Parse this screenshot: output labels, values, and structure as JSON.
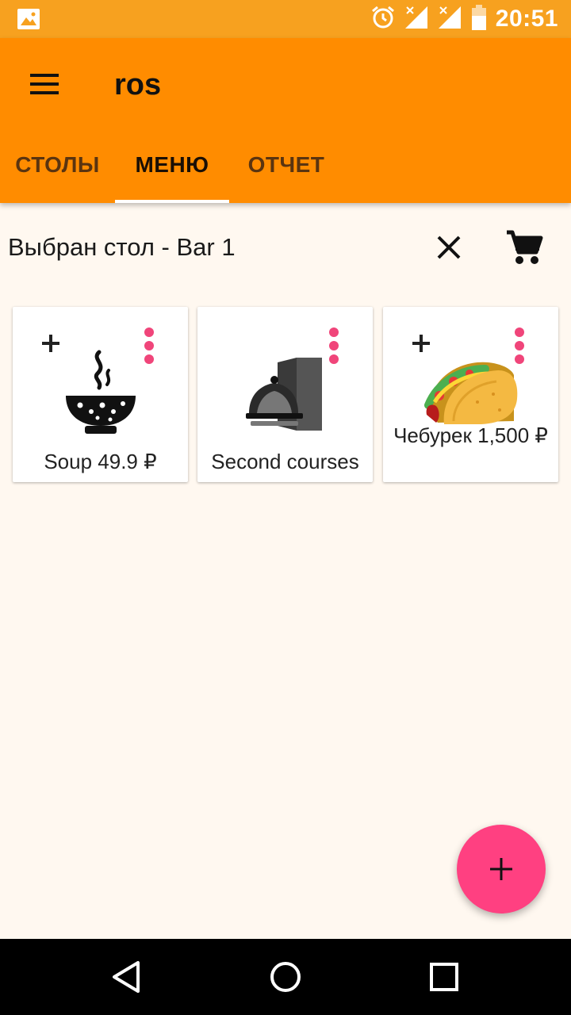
{
  "status_bar": {
    "time": "20:51",
    "icons": [
      "gallery-icon",
      "alarm-icon",
      "signal-off-icon",
      "signal-off-icon",
      "battery-icon"
    ]
  },
  "app_bar": {
    "title": "ros",
    "menu_icon": "menu-icon"
  },
  "tabs": [
    {
      "label": "СТОЛЫ",
      "active": false
    },
    {
      "label": "МЕНЮ",
      "active": true
    },
    {
      "label": "ОТЧЕТ",
      "active": false
    }
  ],
  "table_row": {
    "label": "Выбран стол - Bar 1",
    "clear_icon": "close-icon",
    "cart_icon": "cart-icon"
  },
  "menu_items": [
    {
      "name": "Soup 49.9 ₽",
      "image": "soup-bowl-icon",
      "has_add": true
    },
    {
      "name": "Second courses",
      "image": "cloche-door-icon",
      "has_add": false
    },
    {
      "name": "Чебурек 1,500 ₽",
      "image": "taco-image",
      "has_add": true
    }
  ],
  "fab": {
    "icon": "plus-icon"
  },
  "nav_bar": {
    "icons": [
      "back-icon",
      "home-icon",
      "recents-icon"
    ]
  },
  "colors": {
    "status_bar": "#f7a11f",
    "app_bar": "#ff8c00",
    "accent": "#ff4081",
    "background": "#fff8f0"
  }
}
